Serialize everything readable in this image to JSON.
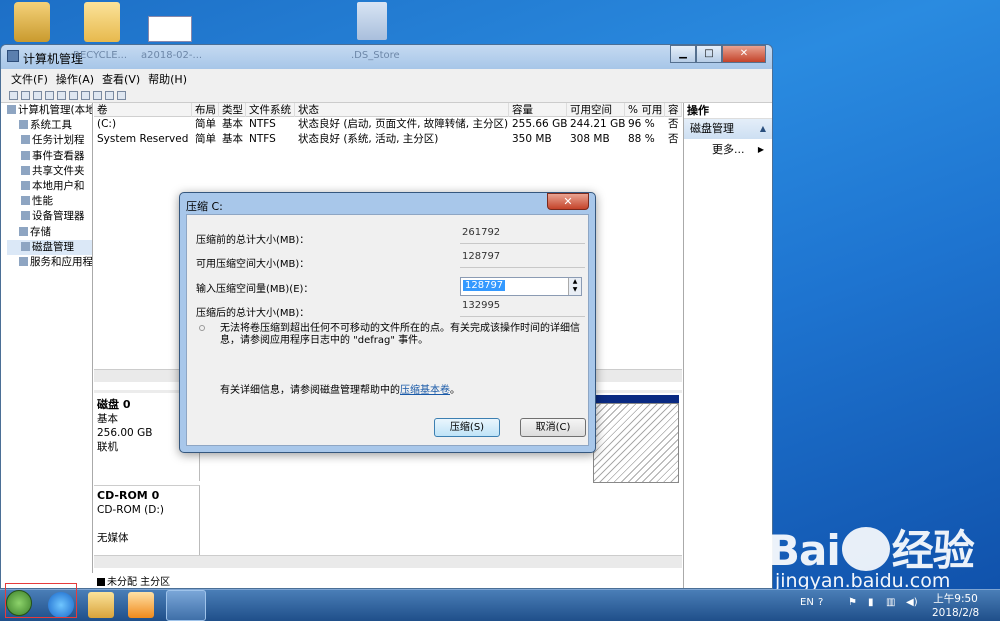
{
  "desktop": {
    "ghost_labels": [
      "RECYCLE...",
      "a2018-02-...",
      ".DS_Store"
    ]
  },
  "window": {
    "title": "计算机管理",
    "menu": [
      "文件(F)",
      "操作(A)",
      "查看(V)",
      "帮助(H)"
    ]
  },
  "tree": {
    "items": [
      {
        "label": "计算机管理(本地"
      },
      {
        "label": "系统工具"
      },
      {
        "label": "任务计划程"
      },
      {
        "label": "事件查看器"
      },
      {
        "label": "共享文件夹"
      },
      {
        "label": "本地用户和"
      },
      {
        "label": "性能"
      },
      {
        "label": "设备管理器"
      },
      {
        "label": "存储"
      },
      {
        "label": "磁盘管理"
      },
      {
        "label": "服务和应用程"
      }
    ]
  },
  "volume_table": {
    "headers": [
      "卷",
      "布局",
      "类型",
      "文件系统",
      "状态",
      "容量",
      "可用空间",
      "% 可用",
      "容"
    ],
    "rows": [
      [
        "(C:)",
        "简单",
        "基本",
        "NTFS",
        "状态良好 (启动, 页面文件, 故障转储, 主分区)",
        "255.66 GB",
        "244.21 GB",
        "96 %",
        "否"
      ],
      [
        "System Reserved",
        "简单",
        "基本",
        "NTFS",
        "状态良好 (系统, 活动, 主分区)",
        "350 MB",
        "308 MB",
        "88 %",
        "否"
      ]
    ]
  },
  "disks": [
    {
      "name": "磁盘 0",
      "type": "基本",
      "size": "256.00 GB",
      "status": "联机"
    },
    {
      "name": "CD-ROM 0",
      "type": "CD-ROM (D:)",
      "size": "",
      "status": "无媒体"
    }
  ],
  "legend": {
    "label": "未分配 主分区"
  },
  "actions": {
    "header": "操作",
    "section": "磁盘管理",
    "more": "更多..."
  },
  "dialog": {
    "title": "压缩 C:",
    "fields": [
      {
        "label": "压缩前的总计大小(MB)：",
        "value": "261792"
      },
      {
        "label": "可用压缩空间大小(MB)：",
        "value": "128797"
      },
      {
        "label": "输入压缩空间量(MB)(E)：",
        "value": "128797"
      },
      {
        "label": "压缩后的总计大小(MB)：",
        "value": "132995"
      }
    ],
    "message": "无法将卷压缩到超出任何不可移动的文件所在的点。有关完成该操作时间的详细信息，请参阅应用程序日志中的 \"defrag\" 事件。",
    "help_prefix": "有关详细信息，请参阅磁盘管理帮助中的",
    "help_link": "压缩基本卷",
    "help_suffix": "。",
    "ok_button": "压缩(S)",
    "cancel_button": "取消(C)",
    "close_glyph": "✕"
  },
  "taskbar": {
    "lang": "EN",
    "time": "上午9:50",
    "date": "2018/2/8"
  },
  "watermark": {
    "logo_left": "Bai",
    "logo_right": "经验",
    "url": "jingyan.baidu.com"
  }
}
